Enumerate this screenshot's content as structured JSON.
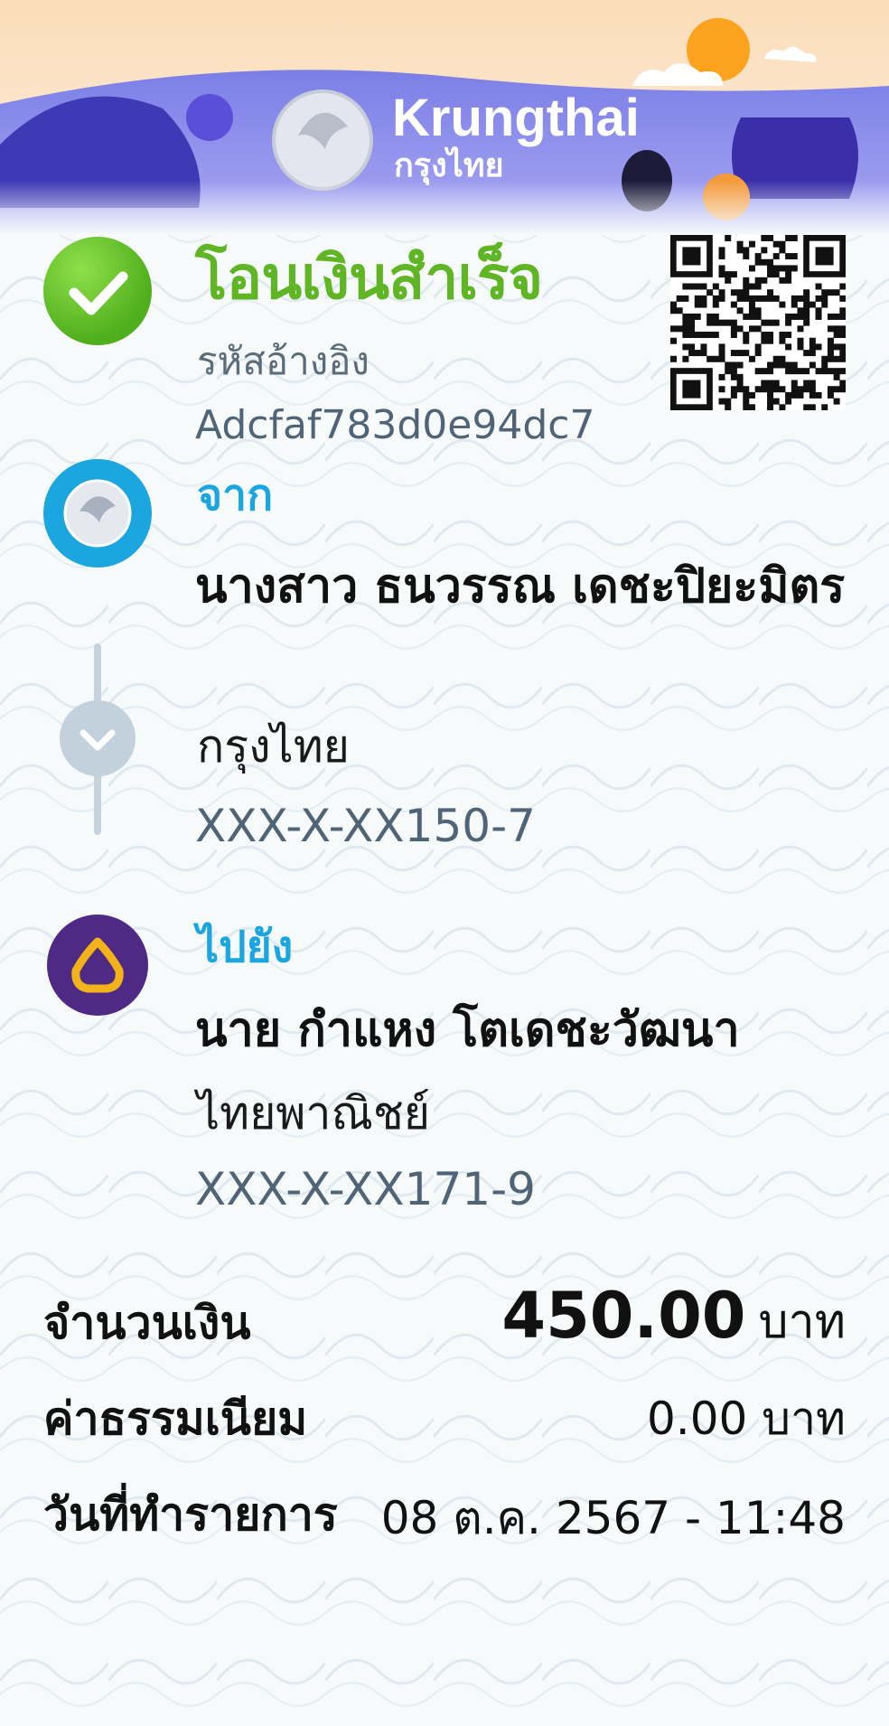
{
  "brand": {
    "name_en": "Krungthai",
    "name_th": "กรุงไทย"
  },
  "status": {
    "title": "โอนเงินสำเร็จ",
    "reference_label": "รหัสอ้างอิง",
    "reference_value": "Adcfaf783d0e94dc7"
  },
  "from": {
    "label": "จาก",
    "name": "นางสาว ธนวรรณ เดชะปิยะมิตร",
    "bank": "กรุงไทย",
    "account": "XXX-X-XX150-7"
  },
  "to": {
    "label": "ไปยัง",
    "name": "นาย กำแหง โตเดชะวัฒนา",
    "bank": "ไทยพาณิชย์",
    "account": "XXX-X-XX171-9"
  },
  "details": {
    "amount_label": "จำนวนเงิน",
    "amount_value": "450.00",
    "amount_unit": "บาท",
    "fee_label": "ค่าธรรมเนียม",
    "fee_value": "0.00 บาท",
    "date_label": "วันที่ทำรายการ",
    "date_value": "08 ต.ค. 2567 - 11:48"
  },
  "colors": {
    "success_green": "#5fb524",
    "krungthai_blue": "#1ba6e0",
    "scb_purple": "#4f2a84",
    "banner_indigo": "#4a45c8"
  },
  "icons": {
    "success": "check-icon",
    "from_bank": "krungthai-logo-icon",
    "connector": "chevron-down-icon",
    "to_bank": "scb-logo-icon",
    "qr": "qr-code-icon"
  }
}
